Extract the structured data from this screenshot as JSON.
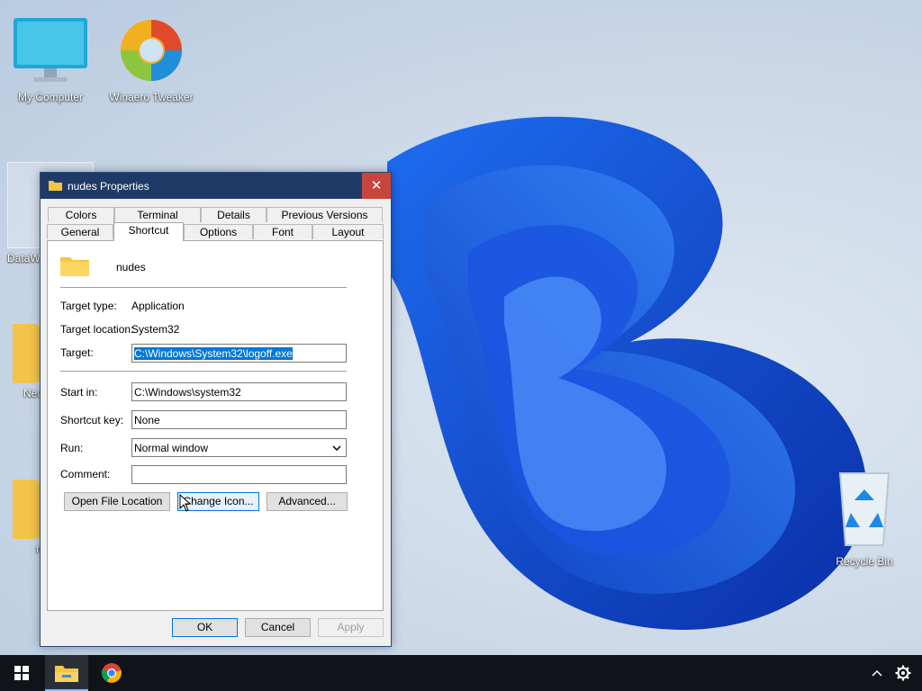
{
  "desktop": {
    "icons": [
      {
        "label": "My Computer"
      },
      {
        "label": "Winaero Tweaker"
      },
      {
        "label": "DataW"
      },
      {
        "label": "New"
      },
      {
        "label": "n"
      },
      {
        "label": "Recycle Bin"
      }
    ]
  },
  "window": {
    "title": "nudes Properties",
    "close_glyph": "✕",
    "tabs_row1": [
      "Colors",
      "Terminal",
      "Details",
      "Previous Versions"
    ],
    "tabs_row2": [
      "General",
      "Shortcut",
      "Options",
      "Font",
      "Layout"
    ],
    "active_tab": "Shortcut",
    "shortcut": {
      "name": "nudes",
      "target_type_label": "Target type:",
      "target_type_value": "Application",
      "target_location_label": "Target location:",
      "target_location_value": "System32",
      "target_label": "Target:",
      "target_value": "C:\\Windows\\System32\\logoff.exe",
      "start_in_label": "Start in:",
      "start_in_value": "C:\\Windows\\system32",
      "shortcut_key_label": "Shortcut key:",
      "shortcut_key_value": "None",
      "run_label": "Run:",
      "run_value": "Normal window",
      "comment_label": "Comment:",
      "comment_value": "",
      "open_file_location": "Open File Location",
      "change_icon": "Change Icon...",
      "advanced": "Advanced..."
    },
    "ok": "OK",
    "cancel": "Cancel",
    "apply": "Apply"
  },
  "taskbar": {
    "items": [
      "start-icon",
      "file-explorer-icon",
      "chrome-icon"
    ],
    "tray": [
      "chevron-up-icon",
      "gear-icon"
    ]
  }
}
